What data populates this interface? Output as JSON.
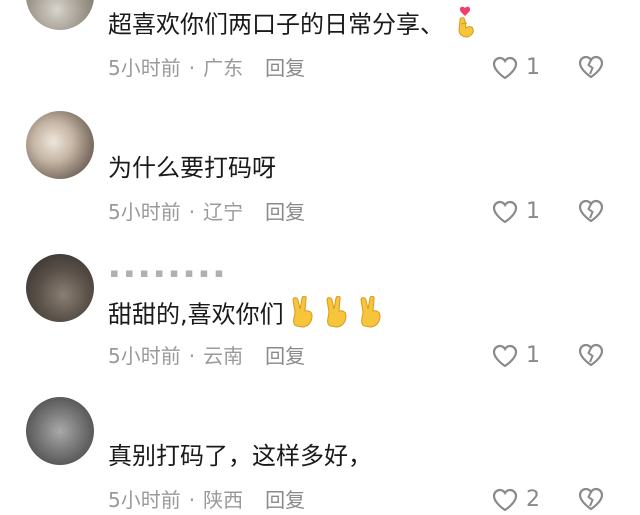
{
  "comments": [
    {
      "username": "",
      "text": "超喜欢你们两口子的日常分享、",
      "emoji_icon": "finger-heart-emoji",
      "time": "5小时前",
      "location": "广东",
      "reply": "回复",
      "likes": "1"
    },
    {
      "username": "",
      "text": "为什么要打码呀",
      "time": "5小时前",
      "location": "辽宁",
      "reply": "回复",
      "likes": "1"
    },
    {
      "username": "▪ ▪ ▪ ▪ ▪ ▪ ▪ ▪",
      "text": "甜甜的,喜欢你们",
      "emoji_icon": "victory-hand-emoji",
      "time": "5小时前",
      "location": "云南",
      "reply": "回复",
      "likes": "1"
    },
    {
      "username": "",
      "text": "真别打码了，这样多好，",
      "time": "5小时前",
      "location": "陕西",
      "reply": "回复",
      "likes": "2"
    }
  ],
  "colors": {
    "text": "#1a1a1a",
    "meta": "#9a9a9a",
    "icon": "#8a8a8a"
  }
}
